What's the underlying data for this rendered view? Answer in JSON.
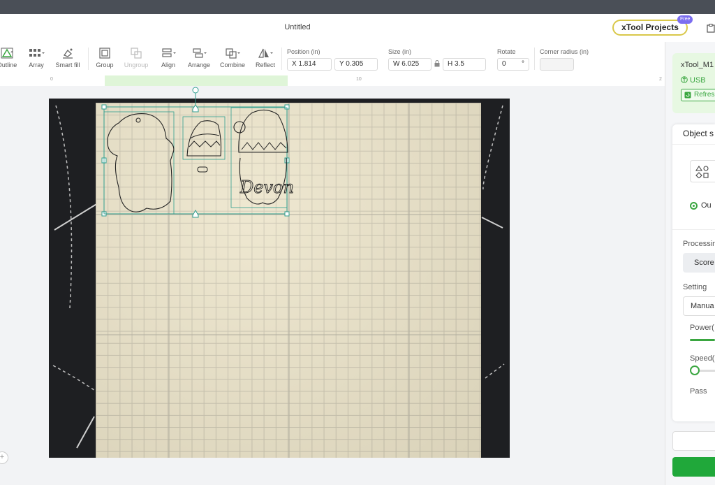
{
  "document": {
    "title": "Untitled"
  },
  "header": {
    "xtool_projects_label": "xTool Projects",
    "free_badge": "Free"
  },
  "toolbar": {
    "tools": {
      "outline": "Outline",
      "array": "Array",
      "smart_fill": "Smart fill",
      "group": "Group",
      "ungroup": "Ungroup",
      "align": "Align",
      "arrange": "Arrange",
      "combine": "Combine",
      "reflect": "Reflect"
    },
    "position_label": "Position (in)",
    "position_x": "X 1.814",
    "position_y": "Y 0.305",
    "size_label": "Size (in)",
    "size_w": "W 6.025",
    "size_h": "H 3.5",
    "rotate_label": "Rotate",
    "rotate_value": "0",
    "rotate_unit": "°",
    "corner_radius_label": "Corner radius (in)",
    "corner_radius_value": ""
  },
  "ruler": {
    "ticks": [
      "0",
      "10",
      "2"
    ]
  },
  "canvas": {
    "engraved_text": "Devon"
  },
  "device": {
    "name": "xTool_M1",
    "connection": "USB",
    "refresh_label": "Refres"
  },
  "object_panel": {
    "title": "Object s",
    "radio_label": "Ou",
    "processing_label": "Processin",
    "processing_value": "Score",
    "setting_label": "Setting",
    "setting_value": "Manua",
    "power_label": "Power(",
    "speed_label": "Speed(",
    "pass_label": "Pass",
    "power_fraction": 1.0,
    "speed_fraction": 0.0
  },
  "colors": {
    "accent": "#3aa640",
    "selection": "#2f9e8f",
    "board": "#ece4c9",
    "bed": "#1e1f22"
  },
  "icons": [
    "outline-icon",
    "array-icon",
    "smart-fill-icon",
    "group-icon",
    "ungroup-icon",
    "align-icon",
    "arrange-icon",
    "combine-icon",
    "reflect-icon",
    "lock-icon",
    "clipboard-icon",
    "shapes-icon",
    "usb-icon",
    "refresh-icon"
  ]
}
